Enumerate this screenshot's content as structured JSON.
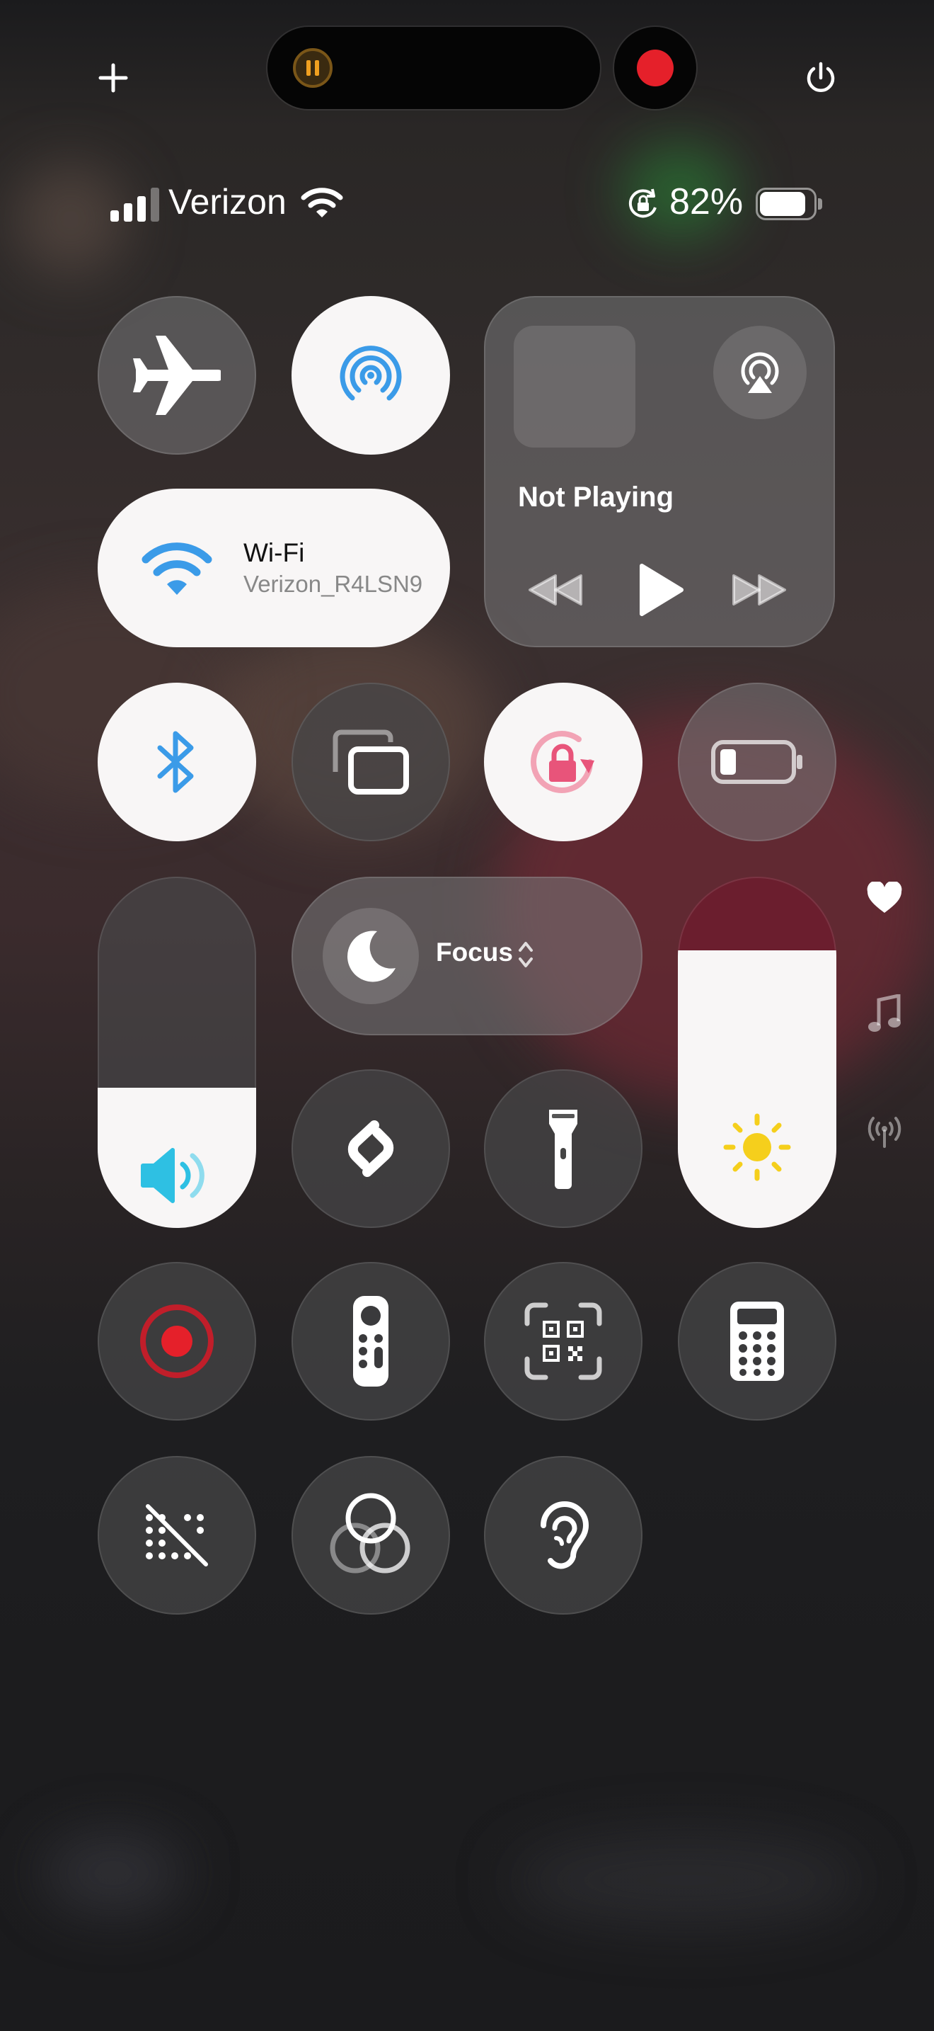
{
  "status_bar": {
    "carrier": "Verizon",
    "battery_percent": "82%",
    "cellular_bars": 3
  },
  "top_controls": {
    "add_icon": "plus-icon",
    "power_icon": "power-icon"
  },
  "now_playing": {
    "title": "Not Playing",
    "controls": [
      "rewind-icon",
      "play-icon",
      "fast-forward-icon"
    ]
  },
  "wifi": {
    "label": "Wi-Fi",
    "network": "Verizon_R4LSN9"
  },
  "focus": {
    "label": "Focus"
  },
  "sliders": {
    "volume_level": 0.4,
    "brightness_level": 0.79
  },
  "colors": {
    "accent_blue": "#3b9be8",
    "record_red": "#e5202a",
    "lock_pink": "#e8547a",
    "sun_yellow": "#f5cf1c",
    "volume_cyan": "#2ec0e3"
  },
  "side_icons": [
    "heart-icon",
    "music-note-icon",
    "antenna-icon"
  ]
}
